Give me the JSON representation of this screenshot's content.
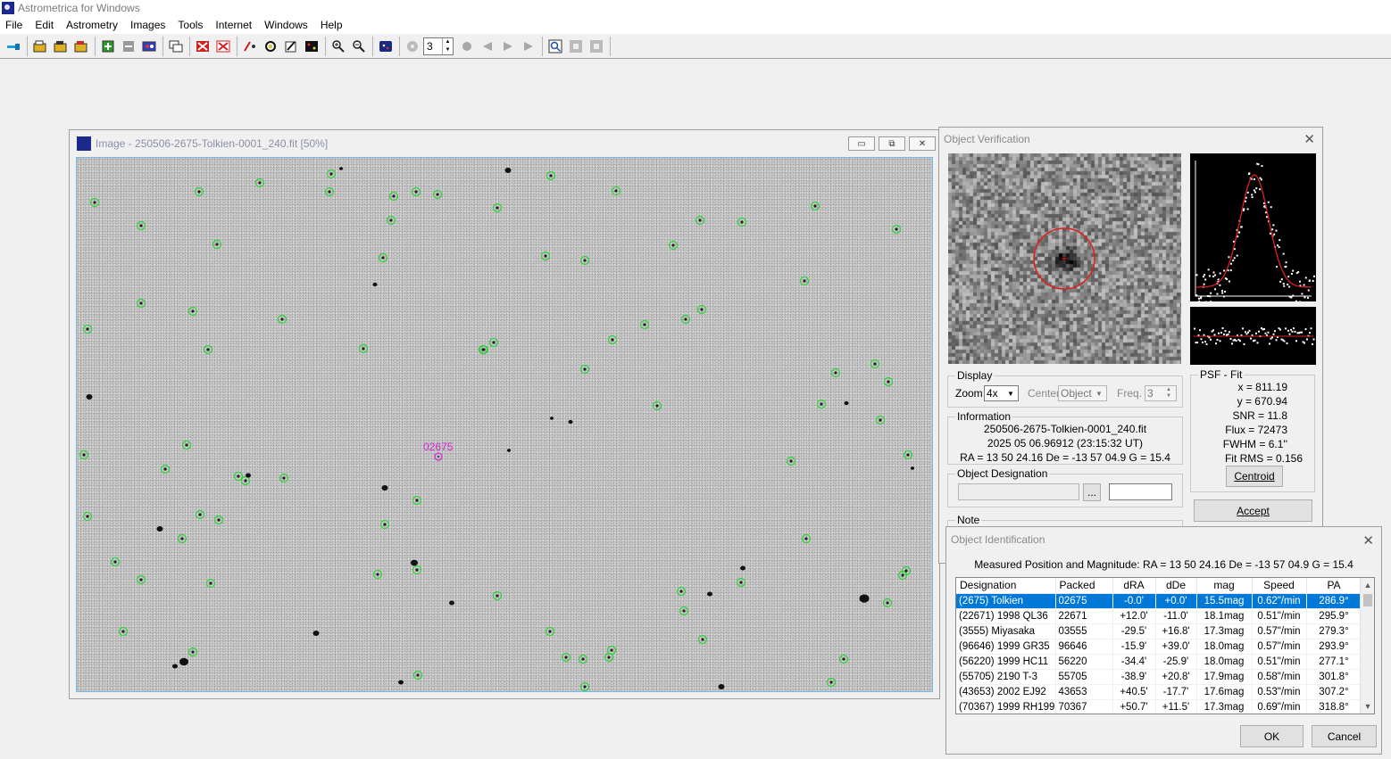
{
  "app": {
    "title": "Astrometrica for Windows",
    "icon": "astrometrica-logo-icon"
  },
  "menu": [
    "File",
    "Edit",
    "Astrometry",
    "Images",
    "Tools",
    "Internet",
    "Windows",
    "Help"
  ],
  "toolbar": {
    "frame_count": "3"
  },
  "image_window": {
    "title": "Image - 250506-2675-Tolkien-0001_240.fit [50%]",
    "target_label": "02675"
  },
  "verification": {
    "title": "Object Verification",
    "display_label": "Display",
    "zoom_label": "Zoom",
    "zoom_value": "4x",
    "center_label": "Center",
    "center_value": "Object",
    "freq_label": "Freq.",
    "freq_value": "3",
    "information_label": "Information",
    "info_file": "250506-2675-Tolkien-0001_240.fit",
    "info_date": "2025 05 06.96912 (23:15:32 UT)",
    "info_coords": "RA = 13 50 24.16   De = -13 57 04.9   G = 15.4",
    "designation_label": "Object Designation",
    "browse_label": "...",
    "note_label": "Note",
    "psf_label": "PSF - Fit",
    "psf": {
      "x": "x = 811.19",
      "y": "y = 670.94",
      "snr": "SNR = 11.8",
      "flux": "Flux = 72473",
      "fwhm": "FWHM = 6.1''",
      "rms": "Fit RMS = 0.156"
    },
    "centroid_label": "Centroid",
    "accept_label": "Accept"
  },
  "identification": {
    "title": "Object Identification",
    "measured": "Measured Position and Magnitude: RA = 13 50 24.16   De = -13 57 04.9   G = 15.4",
    "columns": [
      "Designation",
      "Packed",
      "dRA",
      "dDe",
      "mag",
      "Speed",
      "PA"
    ],
    "rows": [
      [
        "(2675) Tolkien",
        "02675",
        "-0.0'",
        "+0.0'",
        "15.5mag",
        "0.62\"/min",
        "286.9°"
      ],
      [
        "(22671) 1998 QL36",
        "22671",
        "+12.0'",
        "-11.0'",
        "18.1mag",
        "0.51\"/min",
        "295.9°"
      ],
      [
        "(3555) Miyasaka",
        "03555",
        "-29.5'",
        "+16.8'",
        "17.3mag",
        "0.57\"/min",
        "279.3°"
      ],
      [
        "(96646) 1999 GR35",
        "96646",
        "-15.9'",
        "+39.0'",
        "18.0mag",
        "0.57\"/min",
        "293.9°"
      ],
      [
        "(56220) 1999 HC11",
        "56220",
        "-34.4'",
        "-25.9'",
        "18.0mag",
        "0.51\"/min",
        "277.1°"
      ],
      [
        "(55705) 2190 T-3",
        "55705",
        "-38.9'",
        "+20.8'",
        "17.9mag",
        "0.58\"/min",
        "301.8°"
      ],
      [
        "(43653) 2002 EJ92",
        "43653",
        "+40.5'",
        "-17.7'",
        "17.6mag",
        "0.53\"/min",
        "307.2°"
      ],
      [
        "(70367) 1999 RH199",
        "70367",
        "+50.7'",
        "+11.5'",
        "17.3mag",
        "0.69\"/min",
        "318.8°"
      ]
    ],
    "ok_label": "OK",
    "cancel_label": "Cancel"
  },
  "colors": {
    "selection": "#0078d7",
    "star_marker": "#2bd33a",
    "target_marker": "#d42bd4",
    "psf_curve": "#e02020"
  }
}
